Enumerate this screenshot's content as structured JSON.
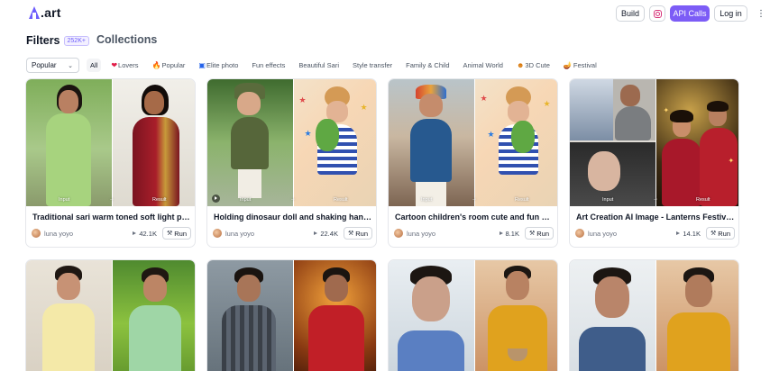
{
  "brand": {
    "logo_text": ".art"
  },
  "header": {
    "build_label": "Build",
    "api_label": "API Calls",
    "login_label": "Log in",
    "more_label": "⋮"
  },
  "tabs": {
    "filters_label": "Filters",
    "filters_count": "252K+",
    "collections_label": "Collections"
  },
  "sort": {
    "selected": "Popular"
  },
  "chips": [
    {
      "label": "All",
      "icon": ""
    },
    {
      "label": "Lovers",
      "icon": "❤"
    },
    {
      "label": "Popular",
      "icon": "🔥"
    },
    {
      "label": "Elite photo",
      "icon": "▣"
    },
    {
      "label": "Fun effects",
      "icon": ""
    },
    {
      "label": "Beautiful Sari",
      "icon": ""
    },
    {
      "label": "Style transfer",
      "icon": ""
    },
    {
      "label": "Family & Child",
      "icon": ""
    },
    {
      "label": "Animal World",
      "icon": ""
    },
    {
      "label": "3D Cute",
      "icon": "☻"
    },
    {
      "label": "Festival",
      "icon": "🪔"
    }
  ],
  "thumb_labels": {
    "input": "Input",
    "result": "Result"
  },
  "cards": [
    {
      "title": "Traditional sari warm toned soft light ph...",
      "author": "luna yoyo",
      "uses": "42.1K",
      "run_label": "Run"
    },
    {
      "title": "Holding dinosaur doll and shaking hands...",
      "author": "luna yoyo",
      "uses": "22.4K",
      "run_label": "Run"
    },
    {
      "title": "Cartoon children's room cute and fun ma...",
      "author": "luna yoyo",
      "uses": "8.1K",
      "run_label": "Run"
    },
    {
      "title": "Art Creation AI Image - Lanterns Festival...",
      "author": "luna yoyo",
      "uses": "14.1K",
      "run_label": "Run"
    }
  ],
  "colors": {
    "accent": "#7c5cf6"
  }
}
